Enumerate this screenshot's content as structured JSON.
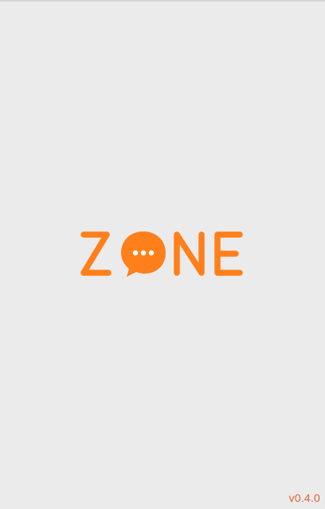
{
  "splash": {
    "logo": {
      "text": "ZONE",
      "icon": "chat-bubble-icon",
      "color": "#ff7f1a",
      "dots_color": "#ffffff"
    },
    "version": "v0.4.0",
    "version_color": "#e2622b",
    "background_color": "#ebebeb"
  }
}
